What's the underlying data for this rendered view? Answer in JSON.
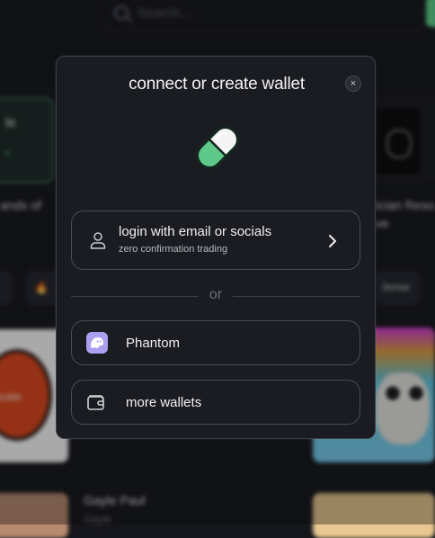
{
  "background": {
    "search_placeholder": "Search...",
    "left_card_title": "le",
    "left_card_line": "•",
    "left_text": "ands of",
    "left_pill_text": "🔥",
    "coin_label": "ecoin",
    "bottom_name": "Gayle Paul",
    "bottom_sub": "Gayle",
    "right_text": "ician Reso",
    "right_text2": "ve",
    "right_pill_text": "Jense"
  },
  "modal": {
    "title": "connect or create wallet",
    "close_symbol": "×",
    "login": {
      "title": "login with email or socials",
      "subtitle": "zero confirmation trading"
    },
    "divider_text": "or",
    "wallets": [
      {
        "label": "Phantom",
        "icon": "phantom-icon"
      },
      {
        "label": "more wallets",
        "icon": "wallet-icon"
      }
    ]
  },
  "colors": {
    "modal_bg": "#1b1c21",
    "border": "#4a4d55",
    "pill_green": "#5fc98a",
    "phantom_purple": "#ab9ff2"
  }
}
